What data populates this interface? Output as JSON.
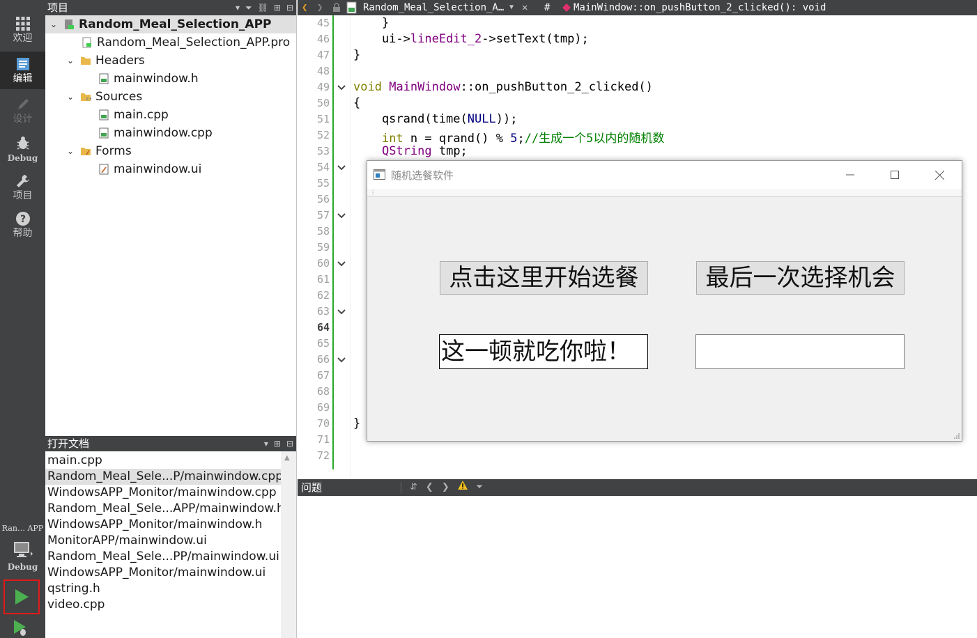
{
  "mode_bar": {
    "items": [
      {
        "label": "欢迎",
        "icon": "grid-icon",
        "state": "normal"
      },
      {
        "label": "编辑",
        "icon": "edit-document-icon",
        "state": "active"
      },
      {
        "label": "设计",
        "icon": "pencil-icon",
        "state": "disabled"
      },
      {
        "label": "Debug",
        "icon": "bug-icon",
        "state": "normal"
      },
      {
        "label": "项目",
        "icon": "wrench-icon",
        "state": "normal"
      },
      {
        "label": "帮助",
        "icon": "help-icon",
        "state": "normal"
      }
    ],
    "kit_name": "Ran… APP",
    "kit_build": "Debug",
    "run_highlight_color": "#e01b1b"
  },
  "project_panel": {
    "title": "项目",
    "tree": [
      {
        "label": "Random_Meal_Selection_APP",
        "level": 0,
        "expanded": true,
        "icon": "qt-project-icon",
        "bold": true,
        "selected": true
      },
      {
        "label": "Random_Meal_Selection_APP.pro",
        "level": 1,
        "icon": "pro-file-icon"
      },
      {
        "label": "Headers",
        "level": 1,
        "expanded": true,
        "icon": "folder-h-icon"
      },
      {
        "label": "mainwindow.h",
        "level": 2,
        "icon": "header-file-icon"
      },
      {
        "label": "Sources",
        "level": 1,
        "expanded": true,
        "icon": "folder-cpp-icon"
      },
      {
        "label": "main.cpp",
        "level": 2,
        "icon": "cpp-file-icon"
      },
      {
        "label": "mainwindow.cpp",
        "level": 2,
        "icon": "cpp-file-icon"
      },
      {
        "label": "Forms",
        "level": 1,
        "expanded": true,
        "icon": "folder-ui-icon"
      },
      {
        "label": "mainwindow.ui",
        "level": 2,
        "icon": "ui-file-icon"
      }
    ]
  },
  "open_docs": {
    "title": "打开文档",
    "items": [
      {
        "label": "main.cpp",
        "selected": false
      },
      {
        "label": "Random_Meal_Sele...P/mainwindow.cpp",
        "selected": true
      },
      {
        "label": "WindowsAPP_Monitor/mainwindow.cpp",
        "selected": false
      },
      {
        "label": "Random_Meal_Sele...APP/mainwindow.h",
        "selected": false
      },
      {
        "label": "WindowsAPP_Monitor/mainwindow.h",
        "selected": false
      },
      {
        "label": "MonitorAPP/mainwindow.ui",
        "selected": false
      },
      {
        "label": "Random_Meal_Sele...PP/mainwindow.ui",
        "selected": false
      },
      {
        "label": "WindowsAPP_Monitor/mainwindow.ui",
        "selected": false
      },
      {
        "label": "qstring.h",
        "selected": false
      },
      {
        "label": "video.cpp",
        "selected": false
      }
    ]
  },
  "editor_toolbar": {
    "file_name": "Random_Meal_Selection_A…",
    "hash": "#",
    "symbol": "MainWindow::on_pushButton_2_clicked(): void"
  },
  "editor": {
    "current_line": 64,
    "gutter_color": "#26a826",
    "lines": [
      {
        "n": 45,
        "fold": false
      },
      {
        "n": 46,
        "fold": false
      },
      {
        "n": 47,
        "fold": false
      },
      {
        "n": 48,
        "fold": false
      },
      {
        "n": 49,
        "fold": true
      },
      {
        "n": 50,
        "fold": false
      },
      {
        "n": 51,
        "fold": false
      },
      {
        "n": 52,
        "fold": false
      },
      {
        "n": 53,
        "fold": false
      },
      {
        "n": 54,
        "fold": true
      },
      {
        "n": 55,
        "fold": false
      },
      {
        "n": 56,
        "fold": false
      },
      {
        "n": 57,
        "fold": true
      },
      {
        "n": 58,
        "fold": false
      },
      {
        "n": 59,
        "fold": false
      },
      {
        "n": 60,
        "fold": true
      },
      {
        "n": 61,
        "fold": false
      },
      {
        "n": 62,
        "fold": false
      },
      {
        "n": 63,
        "fold": true
      },
      {
        "n": 64,
        "fold": false
      },
      {
        "n": 65,
        "fold": false
      },
      {
        "n": 66,
        "fold": true
      },
      {
        "n": 67,
        "fold": false
      },
      {
        "n": 68,
        "fold": false
      },
      {
        "n": 69,
        "fold": false
      },
      {
        "n": 70,
        "fold": false
      },
      {
        "n": 71,
        "fold": false
      },
      {
        "n": 72,
        "fold": false
      }
    ],
    "code": {
      "l45": "    }",
      "l46_a": "    ui->",
      "l46_b": "lineEdit_2",
      "l46_c": "->setText(tmp);",
      "l47": "}",
      "l49_kw": "void",
      "l49_cls": "MainWindow",
      "l49_rest": "::on_pushButton_2_clicked()",
      "l50": "{",
      "l51_a": "    qsrand(time(",
      "l51_b": "NULL",
      "l51_c": "));",
      "l52_kw": "int",
      "l52_a": " n = qrand() % ",
      "l52_num": "5",
      "l52_b": ";",
      "l52_cm": "//生成一个5以内的随机数",
      "l53_ty": "QString",
      "l53_rest": " tmp;",
      "l70": "}"
    }
  },
  "app_window": {
    "title": "随机选餐软件",
    "button_start": "点击这里开始选餐",
    "button_last": "最后一次选择机会",
    "field_result": "这一顿就吃你啦！",
    "field_empty": ""
  },
  "issues_panel": {
    "title": "问题"
  }
}
